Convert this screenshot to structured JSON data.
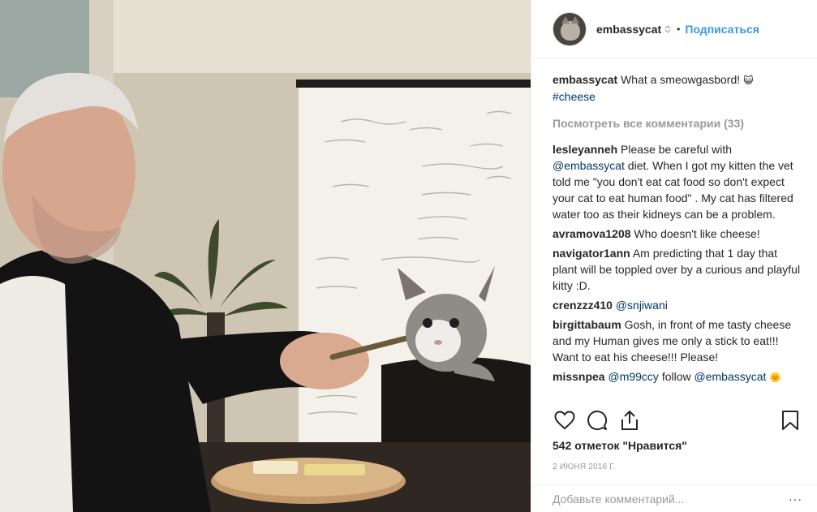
{
  "post": {
    "username": "embassycat",
    "follow_label": "Подписаться",
    "separator": "•",
    "view_all": "Посмотреть все комментарии (33)",
    "likes": "542 отметок \"Нравится\"",
    "date": "2 ИЮНЯ 2016 Г.",
    "add_comment_placeholder": "Добавьте комментарий...",
    "more_label": "···"
  },
  "caption": {
    "user": "embassycat",
    "text": "What a smeowgasbord! ",
    "emoji": "😺",
    "hashtag": "#cheese"
  },
  "comments": [
    {
      "user": "lesleyanneh",
      "pre": "Please be careful with ",
      "mention": "@embassycat",
      "post": " diet. When I got my kitten the vet told me \"you don't eat cat food so don't expect your cat to eat human food\" . My cat has filtered water too as their kidneys can be a problem."
    },
    {
      "user": "avramova1208",
      "pre": "Who doesn't like cheese!",
      "mention": "",
      "post": ""
    },
    {
      "user": "navigator1ann",
      "pre": "Am predicting that 1 day that plant will be toppled over by a curious and playful kitty :D.",
      "mention": "",
      "post": ""
    },
    {
      "user": "crenzzz410",
      "pre": "",
      "mention": "@snjiwani",
      "post": ""
    },
    {
      "user": "birgittabaum",
      "pre": "Gosh, in front of me tasty cheese and my Human gives me only a stick to eat!!! Want to eat his cheese!!! Please!",
      "mention": "",
      "post": ""
    },
    {
      "user": "missnpea",
      "pre": "",
      "mention": "@m99ccy",
      "post": " follow ",
      "mention2": "@embassycat",
      "emoji": "🌞"
    }
  ],
  "icons": {
    "like": "heart-outline-icon",
    "comment": "speech-bubble-icon",
    "share": "share-icon",
    "save": "bookmark-icon"
  },
  "colors": {
    "link": "#3897f0",
    "mention": "#003569",
    "muted": "#999999"
  }
}
